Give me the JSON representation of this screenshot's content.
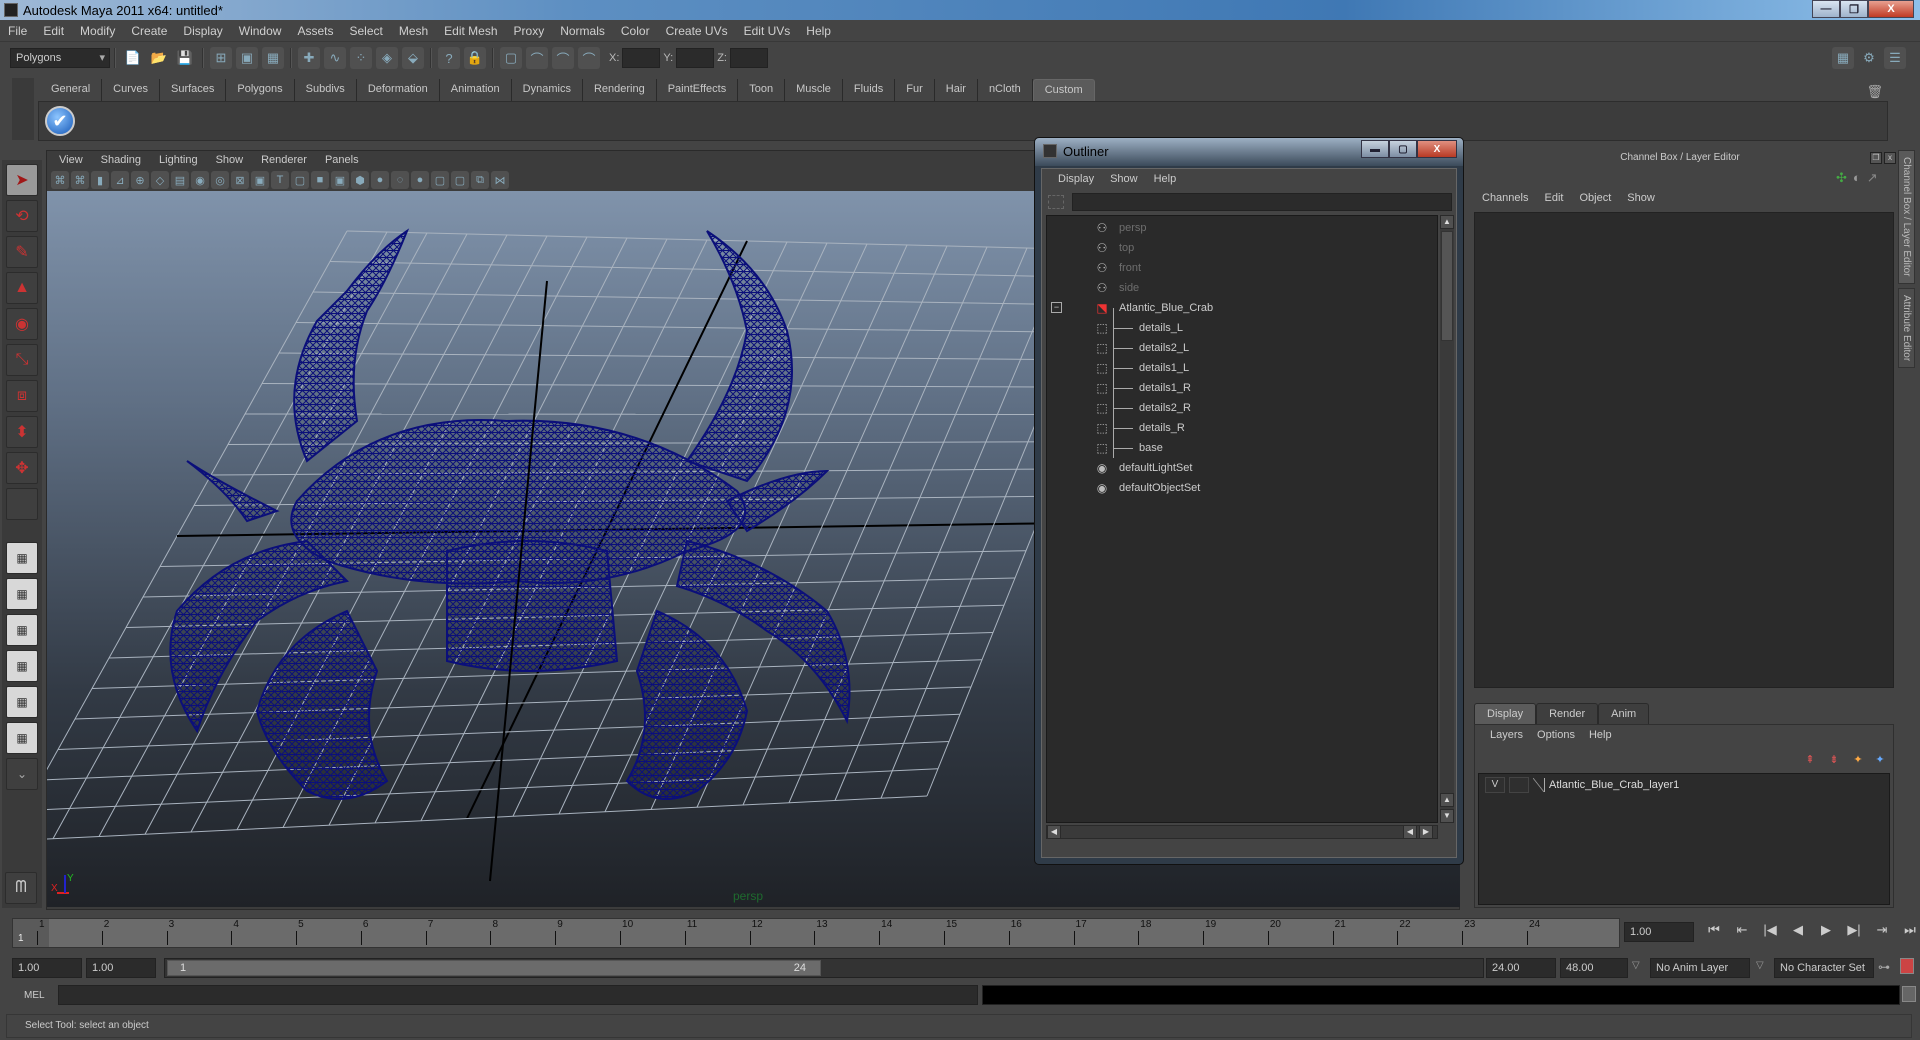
{
  "window": {
    "title": "Autodesk Maya 2011 x64: untitled*",
    "minimize": "—",
    "maximize": "❐",
    "close": "X"
  },
  "menubar": [
    "File",
    "Edit",
    "Modify",
    "Create",
    "Display",
    "Window",
    "Assets",
    "Select",
    "Mesh",
    "Edit Mesh",
    "Proxy",
    "Normals",
    "Color",
    "Create UVs",
    "Edit UVs",
    "Help"
  ],
  "statusline": {
    "mode": "Polygons",
    "icons": [
      "new-scene",
      "open-scene",
      "save-scene",
      "select-by-hierarchy",
      "select-by-object",
      "select-by-component",
      "snap-grid",
      "snap-curve",
      "snap-point",
      "snap-surface",
      "snap-live",
      "history",
      "render-current",
      "ipr-render",
      "render-settings",
      "hypershade",
      "transform-x-field"
    ],
    "x_label": "X:",
    "y_label": "Y:",
    "z_label": "Z:"
  },
  "shelf": {
    "tabs": [
      "General",
      "Curves",
      "Surfaces",
      "Polygons",
      "Subdivs",
      "Deformation",
      "Animation",
      "Dynamics",
      "Rendering",
      "PaintEffects",
      "Toon",
      "Muscle",
      "Fluids",
      "Fur",
      "Hair",
      "nCloth",
      "Custom"
    ],
    "active_tab": "Custom"
  },
  "toolbox": {
    "tools": [
      "select-tool",
      "lasso-tool",
      "paint-select-tool",
      "move-tool",
      "rotate-tool",
      "scale-tool",
      "universal-manipulator",
      "soft-mod-tool",
      "show-manipulator",
      "last-tool"
    ],
    "layouts": [
      "single-pane",
      "four-pane",
      "outliner-persp",
      "persp-graph",
      "hypershade-persp",
      "persp-graph-hypergraph",
      "more-layouts"
    ]
  },
  "viewport": {
    "menu": [
      "View",
      "Shading",
      "Lighting",
      "Show",
      "Renderer",
      "Panels"
    ],
    "camera_label": "persp",
    "wireframe_color": "#0b0f7a",
    "axis": {
      "x": "X",
      "y": "Y"
    }
  },
  "outliner": {
    "title": "Outliner",
    "menu": [
      "Display",
      "Show",
      "Help"
    ],
    "filter_value": "",
    "items": [
      {
        "label": "persp",
        "icon": "camera",
        "dim": true,
        "depth": 0
      },
      {
        "label": "top",
        "icon": "camera",
        "dim": true,
        "depth": 0
      },
      {
        "label": "front",
        "icon": "camera",
        "dim": true,
        "depth": 0
      },
      {
        "label": "side",
        "icon": "camera",
        "dim": true,
        "depth": 0
      },
      {
        "label": "Atlantic_Blue_Crab",
        "icon": "group",
        "dim": false,
        "depth": 0,
        "expanded": true
      },
      {
        "label": "details_L",
        "icon": "mesh",
        "dim": false,
        "depth": 1
      },
      {
        "label": "details2_L",
        "icon": "mesh",
        "dim": false,
        "depth": 1
      },
      {
        "label": "details1_L",
        "icon": "mesh",
        "dim": false,
        "depth": 1
      },
      {
        "label": "details1_R",
        "icon": "mesh",
        "dim": false,
        "depth": 1
      },
      {
        "label": "details2_R",
        "icon": "mesh",
        "dim": false,
        "depth": 1
      },
      {
        "label": "details_R",
        "icon": "mesh",
        "dim": false,
        "depth": 1
      },
      {
        "label": "base",
        "icon": "mesh",
        "dim": false,
        "depth": 1
      },
      {
        "label": "defaultLightSet",
        "icon": "set",
        "dim": false,
        "depth": 0
      },
      {
        "label": "defaultObjectSet",
        "icon": "set",
        "dim": false,
        "depth": 0
      }
    ]
  },
  "channelbox": {
    "title": "Channel Box / Layer Editor",
    "menu": [
      "Channels",
      "Edit",
      "Object",
      "Show"
    ],
    "side_tabs": [
      "Channel Box / Layer Editor",
      "Attribute Editor"
    ]
  },
  "layer_editor": {
    "tabs": [
      "Display",
      "Render",
      "Anim"
    ],
    "active_tab": "Display",
    "menu": [
      "Layers",
      "Options",
      "Help"
    ],
    "layers": [
      {
        "visible": "V",
        "name": "Atlantic_Blue_Crab_layer1"
      }
    ]
  },
  "timeline": {
    "frames": [
      "1",
      "2",
      "3",
      "4",
      "5",
      "6",
      "7",
      "8",
      "9",
      "10",
      "11",
      "12",
      "13",
      "14",
      "15",
      "16",
      "17",
      "18",
      "19",
      "20",
      "21",
      "22",
      "23",
      "24"
    ],
    "current_frame": "1",
    "current_time_field": "1.00",
    "playback_buttons": [
      "go-to-start",
      "step-back-key",
      "step-back-frame",
      "play-backward",
      "play-forward",
      "step-forward-frame",
      "step-forward-key",
      "go-to-end"
    ]
  },
  "range": {
    "start_time": "1.00",
    "playback_start": "1.00",
    "range_start_label": "1",
    "range_end_label": "24",
    "playback_end": "24.00",
    "end_time": "48.00",
    "anim_layer": "No Anim Layer",
    "character_set": "No Character Set"
  },
  "commandline": {
    "label": "MEL",
    "input": "",
    "output": ""
  },
  "helpline": {
    "text": "Select Tool: select an object"
  }
}
